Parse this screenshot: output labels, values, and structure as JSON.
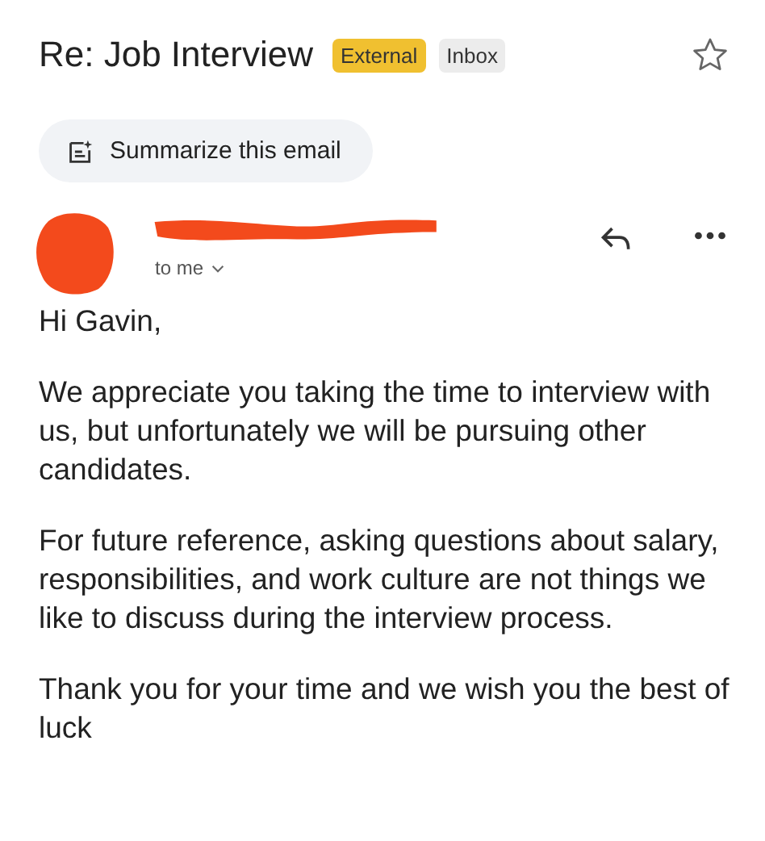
{
  "subject": "Re: Job Interview",
  "labels": [
    {
      "text": "External",
      "color": "#f0c030"
    },
    {
      "text": "Inbox",
      "color": "#ececec"
    }
  ],
  "starred": false,
  "summarize_button": "Summarize this email",
  "sender": {
    "recipient": "to me"
  },
  "body": [
    "Hi Gavin,",
    "We appreciate you taking the time to interview with us, but unfortunately we will be pursuing other candidates.",
    "For future reference, asking questions about salary, responsibilities, and work culture are not things we like to discuss during the interview process.",
    "Thank you for your time and we wish you the best of luck"
  ]
}
